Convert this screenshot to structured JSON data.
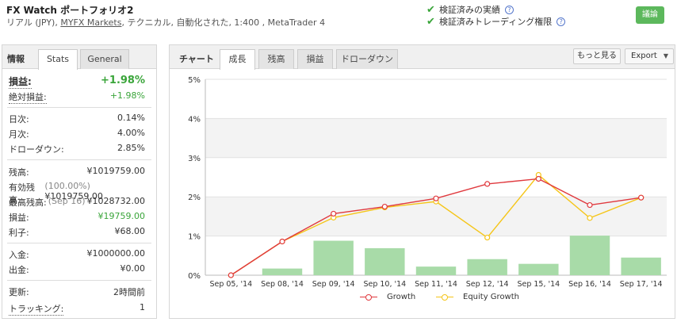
{
  "header": {
    "title": "FX Watch ポートフォリオ2",
    "sub_prefix": "リアル (JPY), ",
    "broker_link": "MYFX Markets",
    "sub_suffix": ", テクニカル, 自動化された, 1:400 , MetaTrader 4",
    "verified_1": "検証済みの実績",
    "verified_2": "検証済みトレーディング権限",
    "discuss_button": "議論"
  },
  "left_panel": {
    "tab_static": "情報",
    "tabs": [
      "Stats",
      "General"
    ],
    "active_tab": "Stats",
    "gain_label": "損益:",
    "gain_value": "+1.98%",
    "abs_gain_label": "絶対損益:",
    "abs_gain_value": "+1.98%",
    "daily_label": "日次:",
    "daily_value": "0.14%",
    "monthly_label": "月次:",
    "monthly_value": "4.00%",
    "drawdown_label": "ドローダウン:",
    "drawdown_value": "2.85%",
    "balance_label": "残高:",
    "balance_value": "¥1019759.00",
    "equity_label": "有効残高:",
    "equity_note": "(100.00%)",
    "equity_value": "¥1019759.00",
    "highest_label": "最高残高:",
    "highest_note": "(Sep 16)",
    "highest_value": "¥1028732.00",
    "profit_label": "損益:",
    "profit_value": "¥19759.00",
    "interest_label": "利子:",
    "interest_value": "¥68.00",
    "deposits_label": "入金:",
    "deposits_value": "¥1000000.00",
    "withdrawals_label": "出金:",
    "withdrawals_value": "¥0.00",
    "updated_label": "更新:",
    "updated_value": "2時間前",
    "tracking_label": "トラッキング:",
    "tracking_value": "1"
  },
  "right_panel": {
    "tab_static": "チャート",
    "tabs": [
      "成長",
      "残高",
      "損益",
      "ドローダウン"
    ],
    "active_tab": "成長",
    "more_button": "もっと見る",
    "export_button": "Export"
  },
  "chart_data": {
    "type": "line",
    "categories": [
      "Sep 05, '14",
      "Sep 08, '14",
      "Sep 09, '14",
      "Sep 10, '14",
      "Sep 11, '14",
      "Sep 12, '14",
      "Sep 15, '14",
      "Sep 16, '14",
      "Sep 17, '14"
    ],
    "y_ticks": [
      "0%",
      "1%",
      "2%",
      "3%",
      "4%",
      "5%"
    ],
    "ylim": [
      0,
      5
    ],
    "grid": true,
    "legend_position": "bottom",
    "series": [
      {
        "name": "Growth",
        "type": "line",
        "color": "#e0393e",
        "values": [
          0,
          0.86,
          1.57,
          1.75,
          1.96,
          2.33,
          2.46,
          1.79,
          1.98
        ]
      },
      {
        "name": "Equity Growth",
        "type": "line",
        "color": "#f5c518",
        "values": [
          0,
          0.86,
          1.47,
          1.73,
          1.88,
          0.96,
          2.56,
          1.46,
          1.98
        ]
      },
      {
        "type": "bar",
        "color": "#a8dba8",
        "values": [
          0,
          0.17,
          0.88,
          0.69,
          0.22,
          0.41,
          0.29,
          1.01,
          0.45
        ]
      }
    ]
  }
}
